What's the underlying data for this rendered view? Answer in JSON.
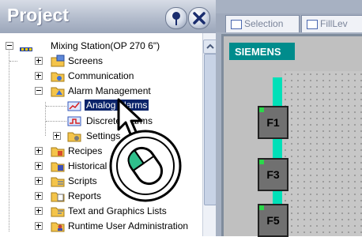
{
  "project": {
    "title": "Project",
    "tree": [
      {
        "label": "Mixing Station(OP 270 6\")",
        "icon": "station-icon",
        "expander": "minus"
      },
      {
        "label": "Screens",
        "icon": "screens-folder-icon",
        "expander": "plus"
      },
      {
        "label": "Communication",
        "icon": "communication-folder-icon",
        "expander": "plus"
      },
      {
        "label": "Alarm Management",
        "icon": "alarm-folder-icon",
        "expander": "minus"
      },
      {
        "label": "Analog Alarms",
        "icon": "analog-alarms-icon",
        "expander": "none",
        "selected": true
      },
      {
        "label": "Discrete Alarms",
        "icon": "discrete-alarms-icon",
        "expander": "none"
      },
      {
        "label": "Settings",
        "icon": "settings-folder-icon",
        "expander": "plus"
      },
      {
        "label": "Recipes",
        "icon": "recipes-folder-icon",
        "expander": "plus"
      },
      {
        "label": "Historical Data",
        "icon": "historical-folder-icon",
        "expander": "plus"
      },
      {
        "label": "Scripts",
        "icon": "scripts-folder-icon",
        "expander": "plus"
      },
      {
        "label": "Reports",
        "icon": "reports-folder-icon",
        "expander": "plus"
      },
      {
        "label": "Text and Graphics Lists",
        "icon": "text-graphics-folder-icon",
        "expander": "plus"
      },
      {
        "label": "Runtime User Administration",
        "icon": "runtime-user-icon",
        "expander": "plus"
      }
    ]
  },
  "tabs": [
    {
      "label": "Selection"
    },
    {
      "label": "FillLev"
    }
  ],
  "screen": {
    "brand": "SIEMENS",
    "function_keys": [
      "F1",
      "F3",
      "F5"
    ]
  },
  "colors": {
    "brand_teal": "#008c8c",
    "selection": "#0a246a",
    "indicator_cyan": "#00e0b8",
    "lamp_green": "#2ad84a"
  }
}
